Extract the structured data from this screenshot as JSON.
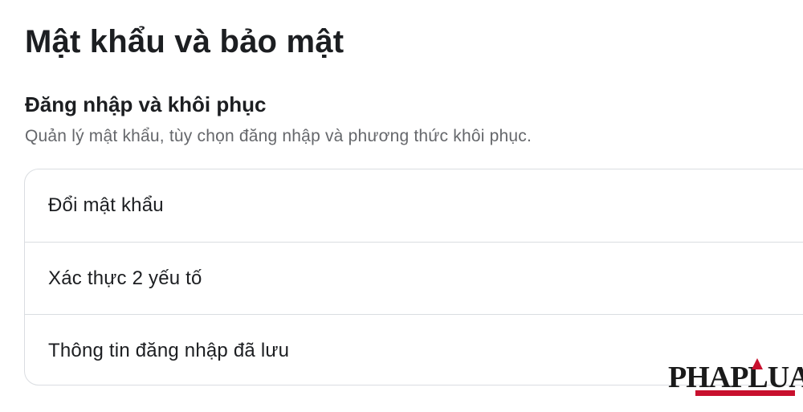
{
  "header": {
    "title": "Mật khẩu và bảo mật"
  },
  "login_section": {
    "title": "Đăng nhập và khôi phục",
    "description": "Quản lý mật khẩu, tùy chọn đăng nhập và phương thức khôi phục.",
    "items": [
      {
        "label": "Đổi mật khẩu"
      },
      {
        "label": "Xác thực 2 yếu tố"
      },
      {
        "label": "Thông tin đăng nhập đã lưu"
      }
    ]
  },
  "watermark": {
    "text": "PHAPLUAT",
    "accent_color": "#c8102e"
  },
  "colors": {
    "text_primary": "#1c1e21",
    "text_secondary": "#65676b",
    "divider": "#dadde1"
  }
}
